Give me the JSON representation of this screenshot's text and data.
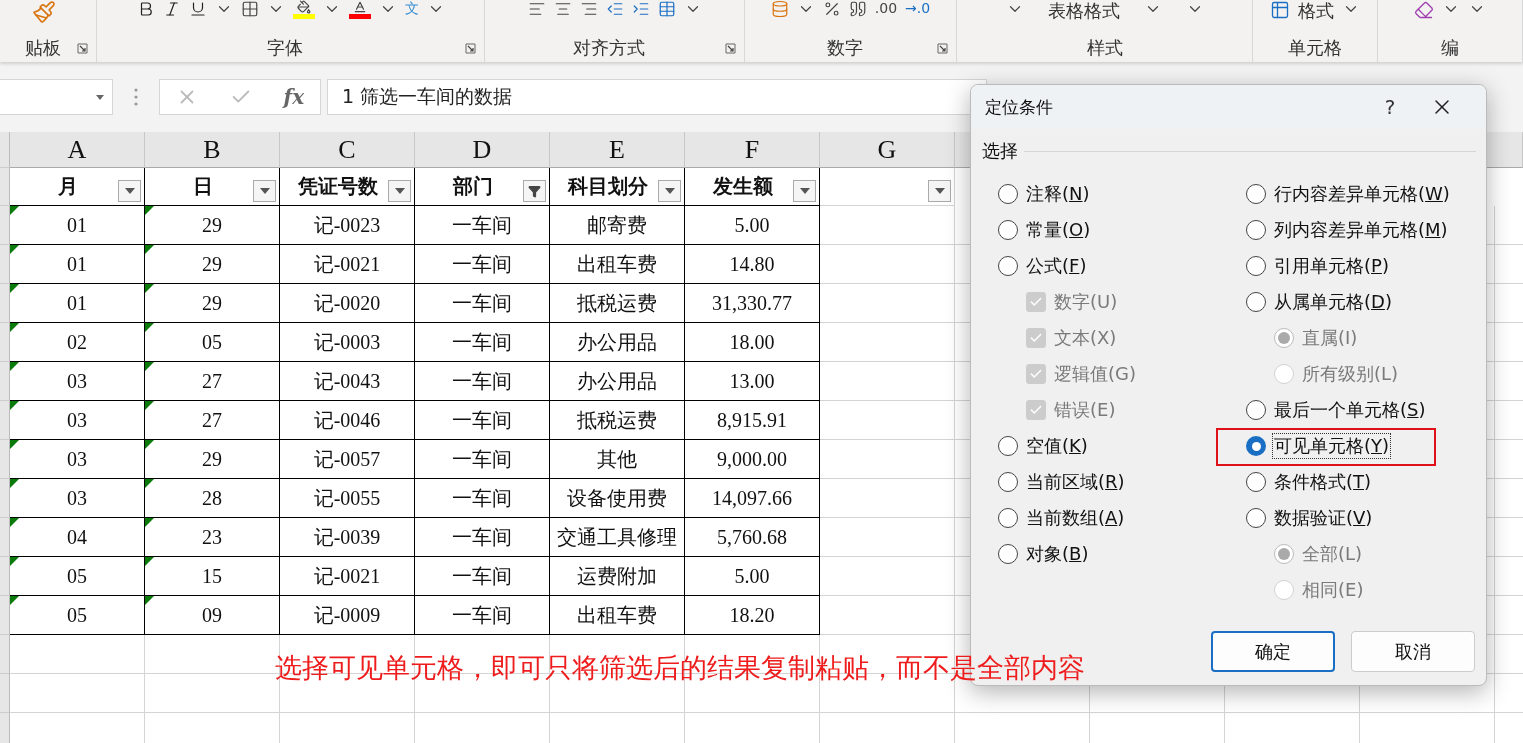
{
  "ribbon": {
    "groups": [
      {
        "kind": "clipboard",
        "label": "贴板",
        "launcher": true
      },
      {
        "kind": "font",
        "label": "字体",
        "launcher": true,
        "phonetic_glyph": "文"
      },
      {
        "kind": "alignment",
        "label": "对齐方式",
        "launcher": true
      },
      {
        "kind": "number",
        "label": "数字",
        "launcher": true,
        "decimal_texts": [
          ".00",
          "→.0"
        ]
      },
      {
        "kind": "styles",
        "label": "样式",
        "table_format": "表格格式"
      },
      {
        "kind": "cells",
        "label": "单元格",
        "format": "格式"
      },
      {
        "kind": "editing",
        "label": "编"
      }
    ]
  },
  "formula_bar": {
    "function_label": "fx",
    "value": "1 筛选一车间的数据"
  },
  "sheet": {
    "columns": [
      {
        "letter": "A",
        "header": "月",
        "filter_active": false,
        "flagged": true
      },
      {
        "letter": "B",
        "header": "日",
        "filter_active": false,
        "flagged": true
      },
      {
        "letter": "C",
        "header": "凭证号数",
        "filter_active": false
      },
      {
        "letter": "D",
        "header": "部门",
        "filter_active": true
      },
      {
        "letter": "E",
        "header": "科目划分",
        "filter_active": false
      },
      {
        "letter": "F",
        "header": "发生额",
        "filter_active": false
      },
      {
        "letter": "G",
        "filter_active": false
      }
    ],
    "rows": [
      {
        "cells": [
          "01",
          "29",
          "记-0023",
          "一车间",
          "邮寄费",
          "5.00"
        ]
      },
      {
        "cells": [
          "01",
          "29",
          "记-0021",
          "一车间",
          "出租车费",
          "14.80"
        ]
      },
      {
        "cells": [
          "01",
          "29",
          "记-0020",
          "一车间",
          "抵税运费",
          "31,330.77"
        ]
      },
      {
        "cells": [
          "02",
          "05",
          "记-0003",
          "一车间",
          "办公用品",
          "18.00"
        ]
      },
      {
        "cells": [
          "03",
          "27",
          "记-0043",
          "一车间",
          "办公用品",
          "13.00"
        ]
      },
      {
        "cells": [
          "03",
          "27",
          "记-0046",
          "一车间",
          "抵税运费",
          "8,915.91"
        ]
      },
      {
        "cells": [
          "03",
          "29",
          "记-0057",
          "一车间",
          "其他",
          "9,000.00"
        ]
      },
      {
        "cells": [
          "03",
          "28",
          "记-0055",
          "一车间",
          "设备使用费",
          "14,097.66"
        ]
      },
      {
        "cells": [
          "04",
          "23",
          "记-0039",
          "一车间",
          "交通工具修理",
          "5,760.68"
        ]
      },
      {
        "cells": [
          "05",
          "15",
          "记-0021",
          "一车间",
          "运费附加",
          "5.00"
        ]
      },
      {
        "cells": [
          "05",
          "09",
          "记-0009",
          "一车间",
          "出租车费",
          "18.20"
        ]
      }
    ]
  },
  "dialog": {
    "title": "定位条件",
    "help": "?",
    "group_label": "选择",
    "left": [
      {
        "kind": "radio",
        "label_parts": [
          "注释(",
          "N",
          ")"
        ],
        "selected": false
      },
      {
        "kind": "radio",
        "label_parts": [
          "常量(",
          "O",
          ")"
        ],
        "selected": false
      },
      {
        "kind": "radio",
        "label_parts": [
          "公式(",
          "F",
          ")"
        ],
        "selected": false,
        "children": [
          {
            "kind": "checkbox",
            "label": "数字(U)",
            "checked": true,
            "disabled": true
          },
          {
            "kind": "checkbox",
            "label": "文本(X)",
            "checked": true,
            "disabled": true
          },
          {
            "kind": "checkbox",
            "label": "逻辑值(G)",
            "checked": true,
            "disabled": true
          },
          {
            "kind": "checkbox",
            "label": "错误(E)",
            "checked": true,
            "disabled": true
          }
        ]
      },
      {
        "kind": "radio",
        "label_parts": [
          "空值(",
          "K",
          ")"
        ],
        "selected": false
      },
      {
        "kind": "radio",
        "label_parts": [
          "当前区域(",
          "R",
          ")"
        ],
        "selected": false
      },
      {
        "kind": "radio",
        "label_parts": [
          "当前数组(",
          "A",
          ")"
        ],
        "selected": false
      },
      {
        "kind": "radio",
        "label_parts": [
          "对象(",
          "B",
          ")"
        ],
        "selected": false
      }
    ],
    "right": [
      {
        "kind": "radio",
        "label_parts": [
          "行内容差异单元格(",
          "W",
          ")"
        ],
        "selected": false
      },
      {
        "kind": "radio",
        "label_parts": [
          "列内容差异单元格(",
          "M",
          ")"
        ],
        "selected": false
      },
      {
        "kind": "radio",
        "label_parts": [
          "引用单元格(",
          "P",
          ")"
        ],
        "selected": false
      },
      {
        "kind": "radio",
        "label_parts": [
          "从属单元格(",
          "D",
          ")"
        ],
        "selected": false,
        "children": [
          {
            "kind": "radio",
            "label": "直属(I)",
            "selected": true,
            "disabled": true
          },
          {
            "kind": "radio",
            "label": "所有级别(L)",
            "selected": false,
            "disabled": true
          }
        ]
      },
      {
        "kind": "radio",
        "label_parts": [
          "最后一个单元格(",
          "S",
          ")"
        ],
        "selected": false
      },
      {
        "kind": "radio",
        "label_parts": [
          "可见单元格(",
          "Y",
          ")"
        ],
        "selected": true,
        "focused": true
      },
      {
        "kind": "radio",
        "label_parts": [
          "条件格式(",
          "T",
          ")"
        ],
        "selected": false
      },
      {
        "kind": "radio",
        "label_parts": [
          "数据验证(",
          "V",
          ")"
        ],
        "selected": false,
        "children": [
          {
            "kind": "radio",
            "label": "全部(L)",
            "selected": true,
            "disabled": true
          },
          {
            "kind": "radio",
            "label": "相同(E)",
            "selected": false,
            "disabled": true
          }
        ]
      }
    ],
    "buttons": [
      {
        "label": "确定",
        "default": true
      },
      {
        "label": "取消",
        "default": false
      }
    ]
  },
  "annotation": {
    "text": "选择可见单元格，即可只将筛选后的结果复制粘贴，而不是全部内容"
  }
}
